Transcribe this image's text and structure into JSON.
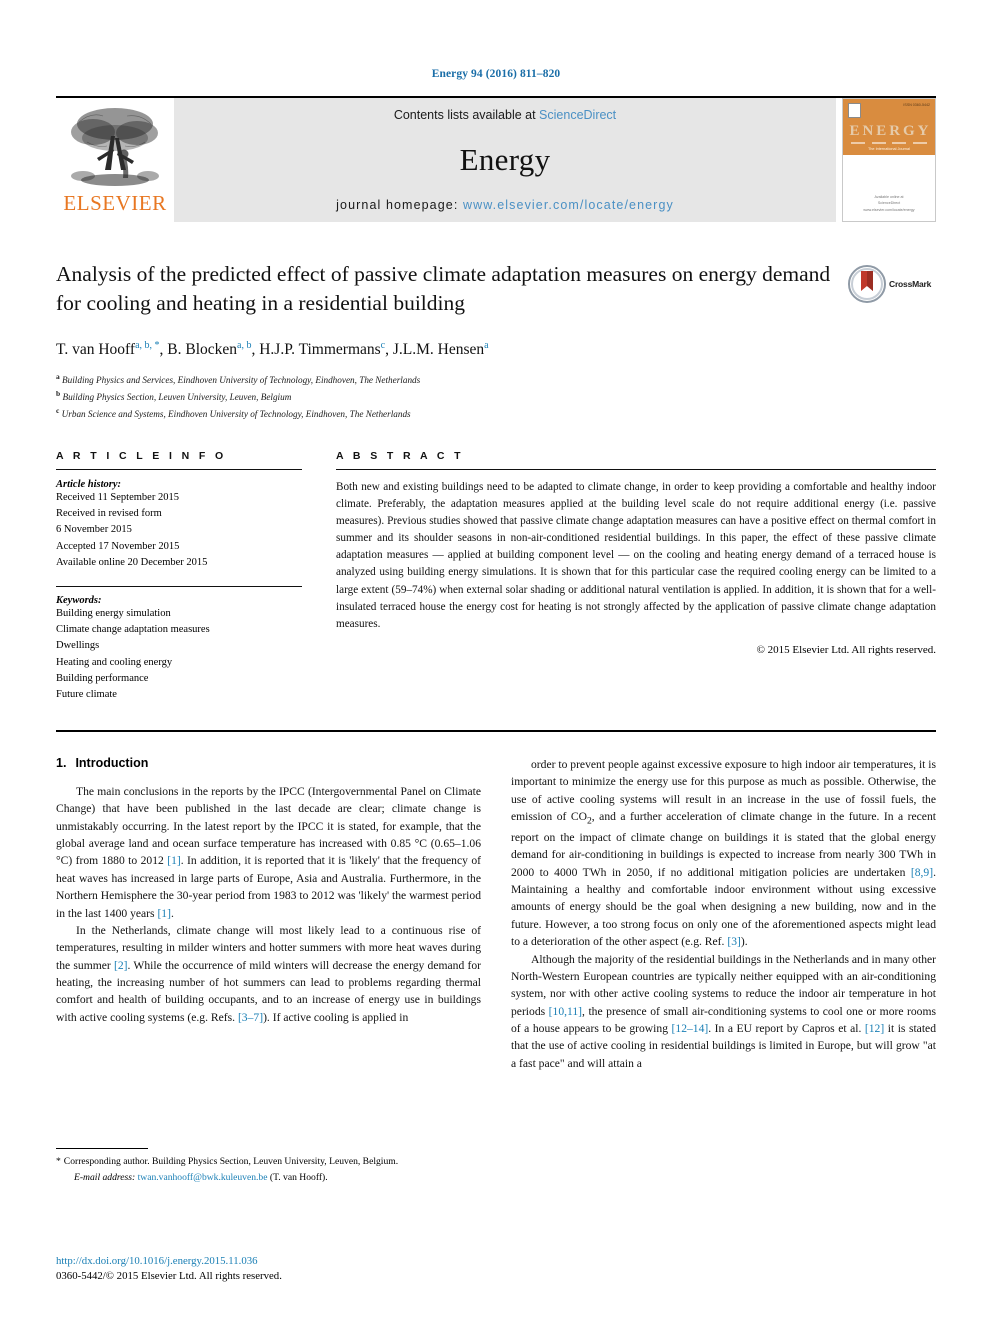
{
  "running_head": "Energy 94 (2016) 811–820",
  "masthead": {
    "publisher": "ELSEVIER",
    "contents_prefix": "Contents lists available at ",
    "contents_link": "ScienceDirect",
    "journal_name": "Energy",
    "homepage_prefix": "journal homepage: ",
    "homepage_url": "www.elsevier.com/locate/energy",
    "cover": {
      "title_letters": [
        "E",
        "N",
        "E",
        "R",
        "G",
        "Y"
      ],
      "subtitle": "The International Journal",
      "issn": "ISSN 0360-5442",
      "footer_line1": "Available online at",
      "footer_line2": "ScienceDirect",
      "footer_line3": "www.elsevier.com/locate/energy"
    }
  },
  "article": {
    "title": "Analysis of the predicted effect of passive climate adaptation measures on energy demand for cooling and heating in a residential building",
    "crossmark_label": "CrossMark",
    "authors": [
      {
        "name": "T. van Hooff",
        "marks": "a, b, *"
      },
      {
        "name": "B. Blocken",
        "marks": "a, b"
      },
      {
        "name": "H.J.P. Timmermans",
        "marks": "c"
      },
      {
        "name": "J.L.M. Hensen",
        "marks": "a"
      }
    ],
    "affiliations": [
      {
        "mark": "a",
        "text": "Building Physics and Services, Eindhoven University of Technology, Eindhoven, The Netherlands"
      },
      {
        "mark": "b",
        "text": "Building Physics Section, Leuven University, Leuven, Belgium"
      },
      {
        "mark": "c",
        "text": "Urban Science and Systems, Eindhoven University of Technology, Eindhoven, The Netherlands"
      }
    ]
  },
  "article_info": {
    "heading": "A R T I C L E   I N F O",
    "history_label": "Article history:",
    "history": [
      "Received 11 September 2015",
      "Received in revised form",
      "6 November 2015",
      "Accepted 17 November 2015",
      "Available online 20 December 2015"
    ],
    "keywords_label": "Keywords:",
    "keywords": [
      "Building energy simulation",
      "Climate change adaptation measures",
      "Dwellings",
      "Heating and cooling energy",
      "Building performance",
      "Future climate"
    ]
  },
  "abstract": {
    "heading": "A B S T R A C T",
    "text": "Both new and existing buildings need to be adapted to climate change, in order to keep providing a comfortable and healthy indoor climate. Preferably, the adaptation measures applied at the building level scale do not require additional energy (i.e. passive measures). Previous studies showed that passive climate change adaptation measures can have a positive effect on thermal comfort in summer and its shoulder seasons in non-air-conditioned residential buildings. In this paper, the effect of these passive climate adaptation measures — applied at building component level — on the cooling and heating energy demand of a terraced house is analyzed using building energy simulations. It is shown that for this particular case the required cooling energy can be limited to a large extent (59–74%) when external solar shading or additional natural ventilation is applied. In addition, it is shown that for a well-insulated terraced house the energy cost for heating is not strongly affected by the application of passive climate change adaptation measures.",
    "copyright": "© 2015 Elsevier Ltd. All rights reserved."
  },
  "introduction": {
    "number": "1.",
    "heading": "Introduction",
    "left_paragraphs": [
      "The main conclusions in the reports by the IPCC (Intergovernmental Panel on Climate Change) that have been published in the last decade are clear; climate change is unmistakably occurring. In the latest report by the IPCC it is stated, for example, that the global average land and ocean surface temperature has increased with 0.85 °C (0.65–1.06 °C) from 1880 to 2012 [1]. In addition, it is reported that it is 'likely' that the frequency of heat waves has increased in large parts of Europe, Asia and Australia. Furthermore, in the Northern Hemisphere the 30-year period from 1983 to 2012 was 'likely' the warmest period in the last 1400 years [1].",
      "In the Netherlands, climate change will most likely lead to a continuous rise of temperatures, resulting in milder winters and hotter summers with more heat waves during the summer [2]. While the occurrence of mild winters will decrease the energy demand for heating, the increasing number of hot summers can lead to problems regarding thermal comfort and health of building occupants, and to an increase of energy use in buildings with active cooling systems (e.g. Refs. [3–7]). If active cooling is applied in"
    ],
    "right_paragraphs": [
      "order to prevent people against excessive exposure to high indoor air temperatures, it is important to minimize the energy use for this purpose as much as possible. Otherwise, the use of active cooling systems will result in an increase in the use of fossil fuels, the emission of CO2, and a further acceleration of climate change in the future. In a recent report on the impact of climate change on buildings it is stated that the global energy demand for air-conditioning in buildings is expected to increase from nearly 300 TWh in 2000 to 4000 TWh in 2050, if no additional mitigation policies are undertaken [8,9]. Maintaining a healthy and comfortable indoor environment without using excessive amounts of energy should be the goal when designing a new building, now and in the future. However, a too strong focus on only one of the aforementioned aspects might lead to a deterioration of the other aspect (e.g. Ref. [3]).",
      "Although the majority of the residential buildings in the Netherlands and in many other North-Western European countries are typically neither equipped with an air-conditioning system, nor with other active cooling systems to reduce the indoor air temperature in hot periods [10,11], the presence of small air-conditioning systems to cool one or more rooms of a house appears to be growing [12–14]. In a EU report by Capros et al. [12] it is stated that the use of active cooling in residential buildings is limited in Europe, but will grow \"at a fast pace\" and will attain a"
    ]
  },
  "footnote": {
    "star": "*",
    "corresponding": "Corresponding author. Building Physics Section, Leuven University, Leuven, Belgium.",
    "email_label": "E-mail address:",
    "email": "twan.vanhooff@bwk.kuleuven.be",
    "email_suffix": "(T. van Hooff)."
  },
  "footer": {
    "doi": "http://dx.doi.org/10.1016/j.energy.2015.11.036",
    "issn_line": "0360-5442/© 2015 Elsevier Ltd. All rights reserved."
  },
  "colors": {
    "link": "#1a7fb5",
    "elsevier_orange": "#e87722",
    "banner_gray": "#e6e6e6"
  }
}
